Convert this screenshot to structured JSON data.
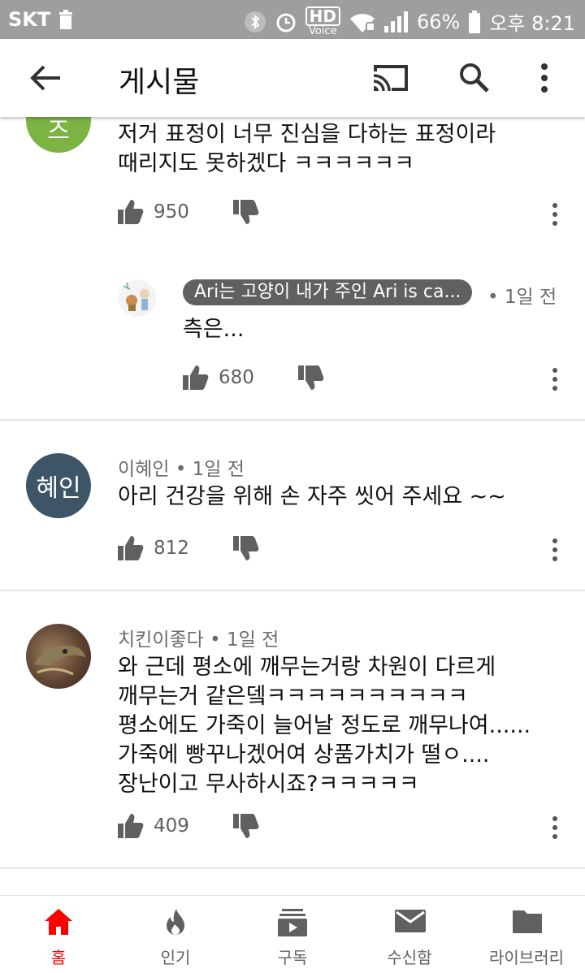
{
  "status_bar": {
    "carrier": "SKT",
    "hd": "HD",
    "voice": "Voice",
    "battery": "66%",
    "time": "오후 8:21"
  },
  "app_bar": {
    "title": "게시물"
  },
  "comments": [
    {
      "avatar_text": "즈",
      "avatar_color": "#7cb342",
      "text_lines": [
        "저거 표정이 너무 진심을 다하는 표정이라",
        "때리지도 못하겠다 ㅋㅋㅋㅋㅋㅋ"
      ],
      "likes": "950"
    },
    {
      "author": "Ari는 고양이 내가 주인  Ari is ca...",
      "time": "• 1일 전",
      "text_lines": [
        "측은..."
      ],
      "likes": "680"
    },
    {
      "author": "이혜인",
      "time": "• 1일 전",
      "avatar_text": "혜인",
      "avatar_color": "#3d5566",
      "text_lines": [
        "아리 건강을 위해 손 자주 씻어 주세요 ~~"
      ],
      "likes": "812"
    },
    {
      "author": "치킨이좋다",
      "time": "• 1일 전",
      "text_lines": [
        "와 근데 평소에 깨무는거랑 차원이 다르게",
        "깨무는거 같은뎈ㅋㅋㅋㅋㅋㅋㅋㅋㅋㅋ",
        "평소에도 가죽이 늘어날 정도로 깨무나여......",
        "가죽에 빵꾸나겠어여 상품가치가 떨ㅇ....",
        "장난이고 무사하시죠?ㅋㅋㅋㅋㅋ"
      ],
      "likes": "409"
    }
  ],
  "bottom_nav": [
    {
      "label": "홈",
      "icon": "home-icon",
      "active": true
    },
    {
      "label": "인기",
      "icon": "fire-icon",
      "active": false
    },
    {
      "label": "구독",
      "icon": "subscriptions-icon",
      "active": false
    },
    {
      "label": "수신함",
      "icon": "mail-icon",
      "active": false
    },
    {
      "label": "라이브러리",
      "icon": "folder-icon",
      "active": false
    }
  ],
  "colors": {
    "active": "#ff0000",
    "icon": "#606060",
    "status_bar": "#9e9e9e"
  }
}
